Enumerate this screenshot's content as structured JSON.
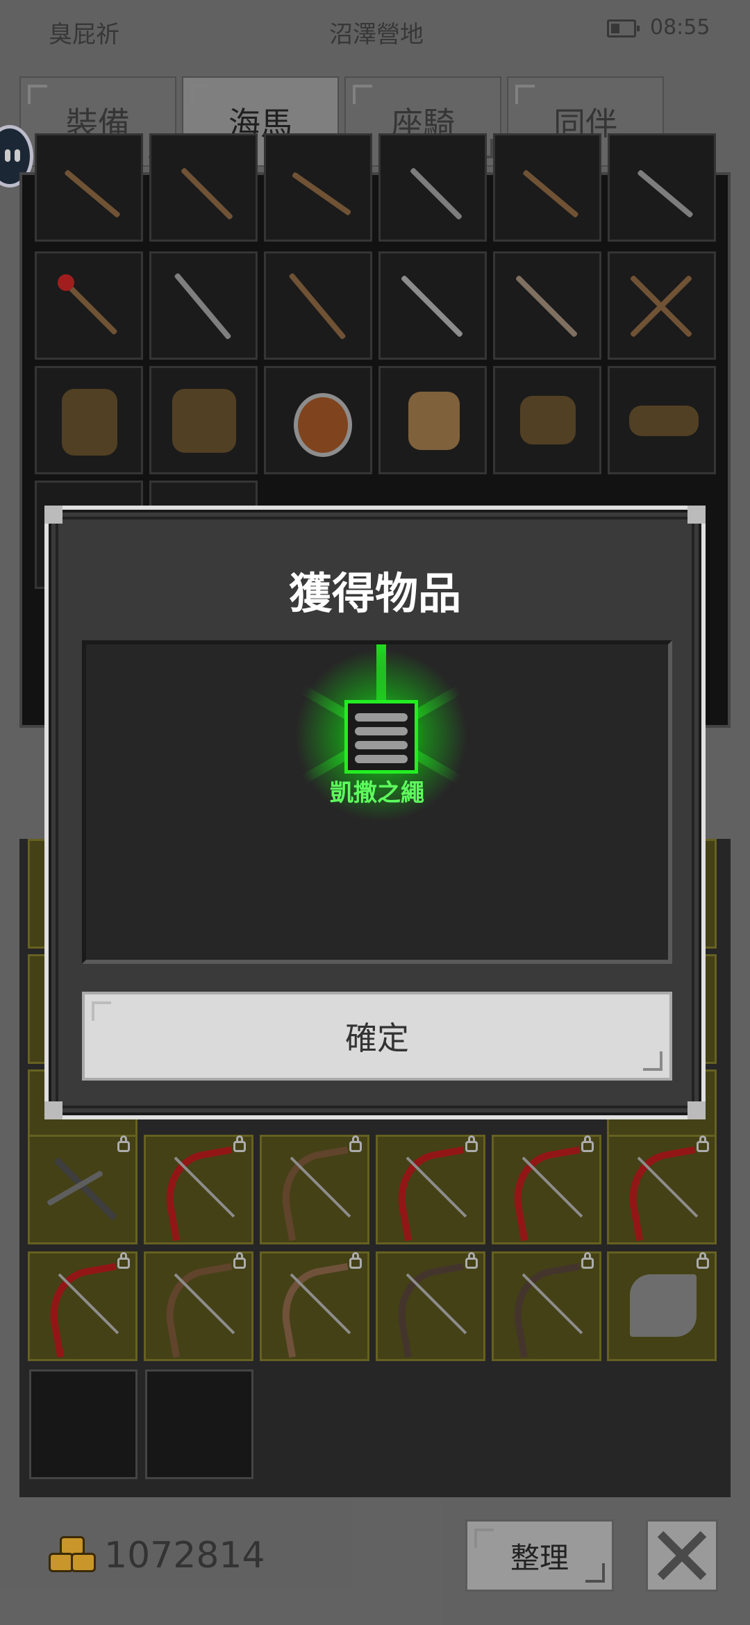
{
  "status_bar": {
    "carrier": "臭屁祈",
    "location": "沼澤營地",
    "time": "08:55"
  },
  "tabs": [
    {
      "label": "裝備",
      "active": false
    },
    {
      "label": "海馬",
      "active": true
    },
    {
      "label": "座騎",
      "active": false
    },
    {
      "label": "同伴",
      "active": false
    }
  ],
  "modal": {
    "title": "獲得物品",
    "reward": {
      "name": "凱撒之繩",
      "icon": "rope-coil-icon",
      "rarity_color": "#22ee22"
    },
    "confirm_label": "確定"
  },
  "footer": {
    "gold": "1072814",
    "sort_label": "整理"
  },
  "colors": {
    "accent_green": "#5dff5d",
    "locked_slot": "#4a4718",
    "bow_red": "#a01818",
    "bow_brown": "#6a4a30"
  }
}
